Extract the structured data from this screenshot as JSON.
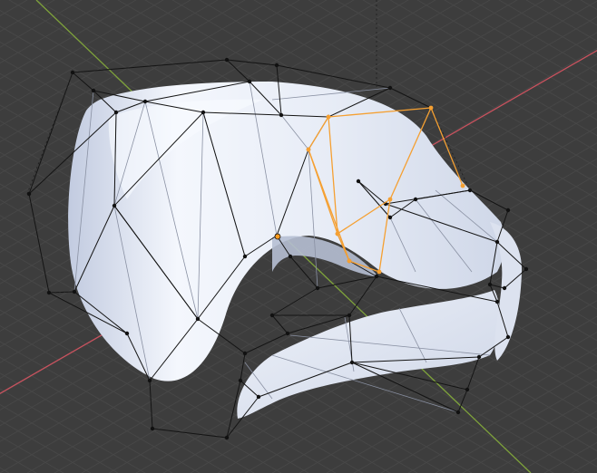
{
  "viewport": {
    "background": "#3d3d3d",
    "grid_color": "#474747",
    "axis_x_color": "#c8525e",
    "axis_y_color": "#7ea23b",
    "mesh_fill": "#e9eef7",
    "mesh_shade": "#c9d2e4",
    "mesh_highlight": "#f8faff",
    "cage_color": "#141414",
    "selected_color": "#f5a032",
    "active_vertex_color": "#ff9b1e"
  },
  "scene": {
    "object": "deformed-tube-mesh",
    "cage": "lattice-cage",
    "selection": "selected-cage-cell"
  }
}
